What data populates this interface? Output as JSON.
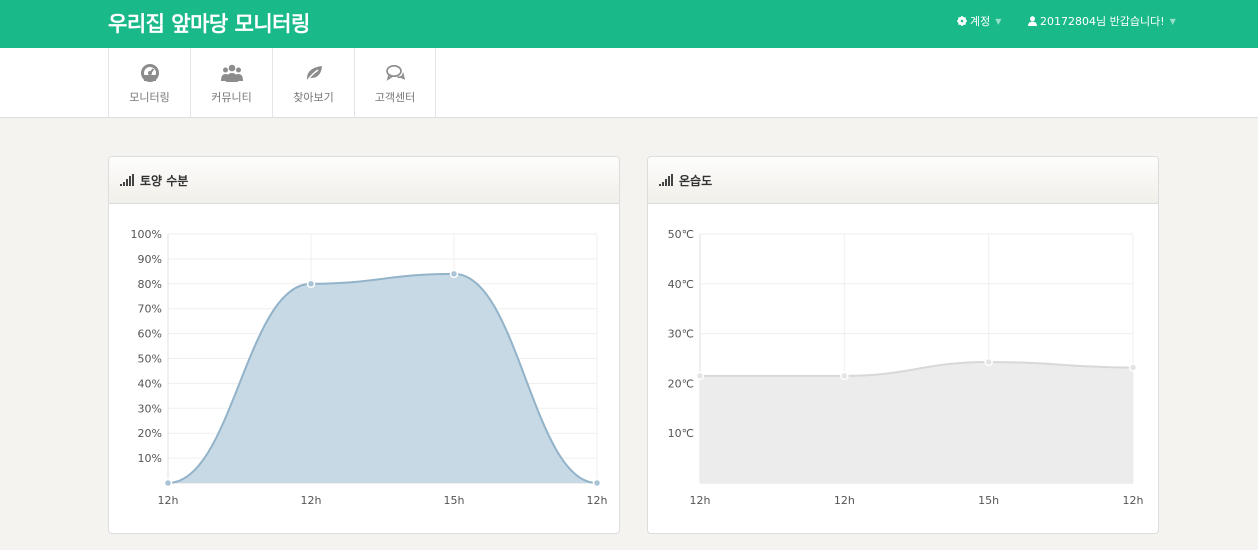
{
  "header": {
    "brand": "우리집 앞마당 모니터링",
    "account_label": "계정",
    "user_greeting": "20172804님 반갑습니다!"
  },
  "nav": {
    "items": [
      {
        "label": "모니터링",
        "icon": "dashboard-icon"
      },
      {
        "label": "커뮤니티",
        "icon": "users-icon"
      },
      {
        "label": "찾아보기",
        "icon": "leaf-icon"
      },
      {
        "label": "고객센터",
        "icon": "comments-icon"
      }
    ]
  },
  "panels": [
    {
      "title": "토양 수분",
      "icon": "signal-bars-icon"
    },
    {
      "title": "온습도",
      "icon": "signal-bars-icon"
    }
  ],
  "chart_data": [
    {
      "type": "area",
      "title": "토양 수분",
      "categories": [
        "12h",
        "12h",
        "15h",
        "12h"
      ],
      "values": [
        0,
        80,
        84,
        0
      ],
      "ylim": [
        0,
        100
      ],
      "yticks": [
        "10%",
        "20%",
        "30%",
        "40%",
        "50%",
        "60%",
        "70%",
        "80%",
        "90%",
        "100%"
      ],
      "grid": true,
      "colors": {
        "fill": "#c7d9e5",
        "line": "#92b3c9",
        "point": "#a9c4d6"
      }
    },
    {
      "type": "area",
      "title": "온습도",
      "categories": [
        "12h",
        "12h",
        "15h",
        "12h"
      ],
      "values": [
        21.5,
        21.5,
        24.3,
        23.2
      ],
      "ylim": [
        0,
        50
      ],
      "yticks": [
        "10℃",
        "20℃",
        "30℃",
        "40℃",
        "50℃"
      ],
      "grid": true,
      "colors": {
        "fill": "#ececec",
        "line": "#d8d8d8",
        "point": "#e4e4e4"
      }
    }
  ]
}
